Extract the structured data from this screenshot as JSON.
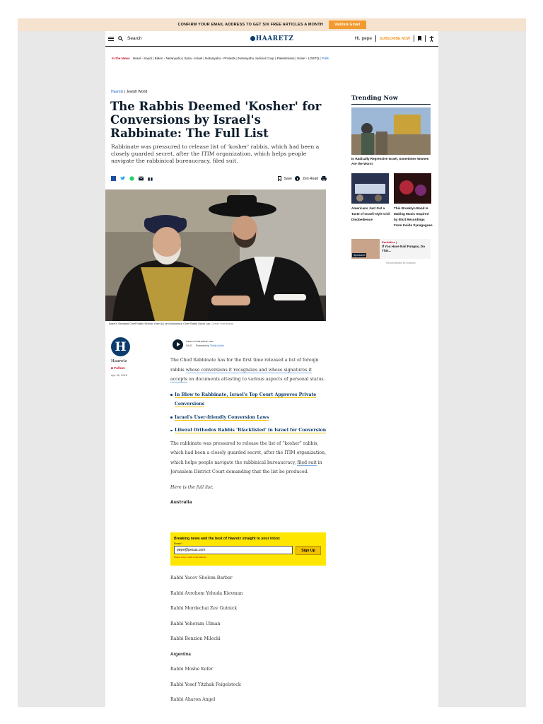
{
  "banner": {
    "text": "CONFIRM YOUR EMAIL ADDRESS TO GET SIX FREE ARTICLES A MONTH",
    "button": "Validate Email"
  },
  "header": {
    "search": "Search",
    "logo": "HAARETZ",
    "user": "Hi, pepe",
    "subscribe": "SUBSCRIBE NOW"
  },
  "in_the_news": {
    "label": "In the News",
    "items": [
      "Israel - Saudi",
      "Biden - Netanyahu",
      "Syria - Israel",
      "Netanyahu - Protests",
      "Netanyahu Judicial Coup",
      "Palestinians",
      "Israel - LGBTQ"
    ],
    "more": "Polls"
  },
  "breadcrumb": {
    "section": "Haaretz",
    "sub": "Jewish World"
  },
  "article": {
    "title": "The Rabbis Deemed 'Kosher' for Conversions by Israel's Rabbinate: The Full List",
    "subtitle": "Rabbinate was pressured to release list of 'kosher' rabbis, which had been a closely guarded secret, after the ITIM organization, which helps people navigate the rabbinical bureaucracy, filed suit.",
    "save": "Save",
    "zen": "Zen Read",
    "caption": "Israel's Sephardi Chief Rabbi Yitzhak Yosef (L) and Ashkenazi Chief Rabbi David Lau.",
    "credit": "Credit: Moti Milrod",
    "author": "Haaretz",
    "follow": "Follow",
    "date": "Apr 18, 2016",
    "listen": {
      "title": "Listen to this article now",
      "time": "04:41",
      "powered": "Powered by",
      "provider": "Trinity Audio"
    },
    "p1_a": "The Chief Rabbinate has for the first time released a list of foreign rabbis ",
    "p1_link": "whose conversions it recognizes and whose signatures it accepts",
    "p1_b": " on documents attesting to various aspects of personal status.",
    "related": [
      "In Blow to Rabbinate, Israel's Top Court Approves Private Conversions",
      "Israel's User-friendly Conversion Laws",
      "Liberal Orthodox Rabbis 'Blacklisted' in Israel for Conversion"
    ],
    "p2_a": "The rabbinate was pressured to release the list of “kosher” rabbis, which had been a closely guarded secret, after the ITIM organization, which helps people navigate the rabbinical bureaucracy, ",
    "p2_link": "filed suit",
    "p2_b": " in Jerusalem District Court demanding that the list be produced.",
    "p3": "Here is the full list:",
    "country1": "Australia"
  },
  "newsletter": {
    "title": "Breaking news and the best of Haaretz straight to your inbox",
    "label": "Email *",
    "value": "pepe@pecas.com",
    "button": "Sign Up",
    "error": "Please enter a valid email address"
  },
  "names": [
    "Rabbi Yacov Sholom Barber",
    "Rabbi Avrohom Yehuda Kievman",
    "Rabbi Mordechai Zev Gutnick",
    "Rabbi Yehoram Ulman",
    "Rabbi Benzion Milecki"
  ],
  "country2": "Argentina",
  "names2": [
    "Rabbi Moshe Kofer",
    "Rabbi Yosef Yitzhak Feigelstock",
    "Rabbi Aharon Angel"
  ],
  "sidebar": {
    "title": "Trending Now",
    "item1": "In Radically Regressive Israel, Sometimes Women Are the Worst",
    "item2": "Americans Just Got a Taste of Israeli-style Civil Disobedience",
    "item3": "This Brooklyn Band Is Making Music Inspired by Illicit Recordings From Inside Synagogues",
    "sponsor_brand": "EarthHive |",
    "sponsor_text": "If You Have Nail Fungus, Do This...",
    "sponsor_tag": "Sponsored",
    "outbrain": "Recommended by Outbrain"
  }
}
